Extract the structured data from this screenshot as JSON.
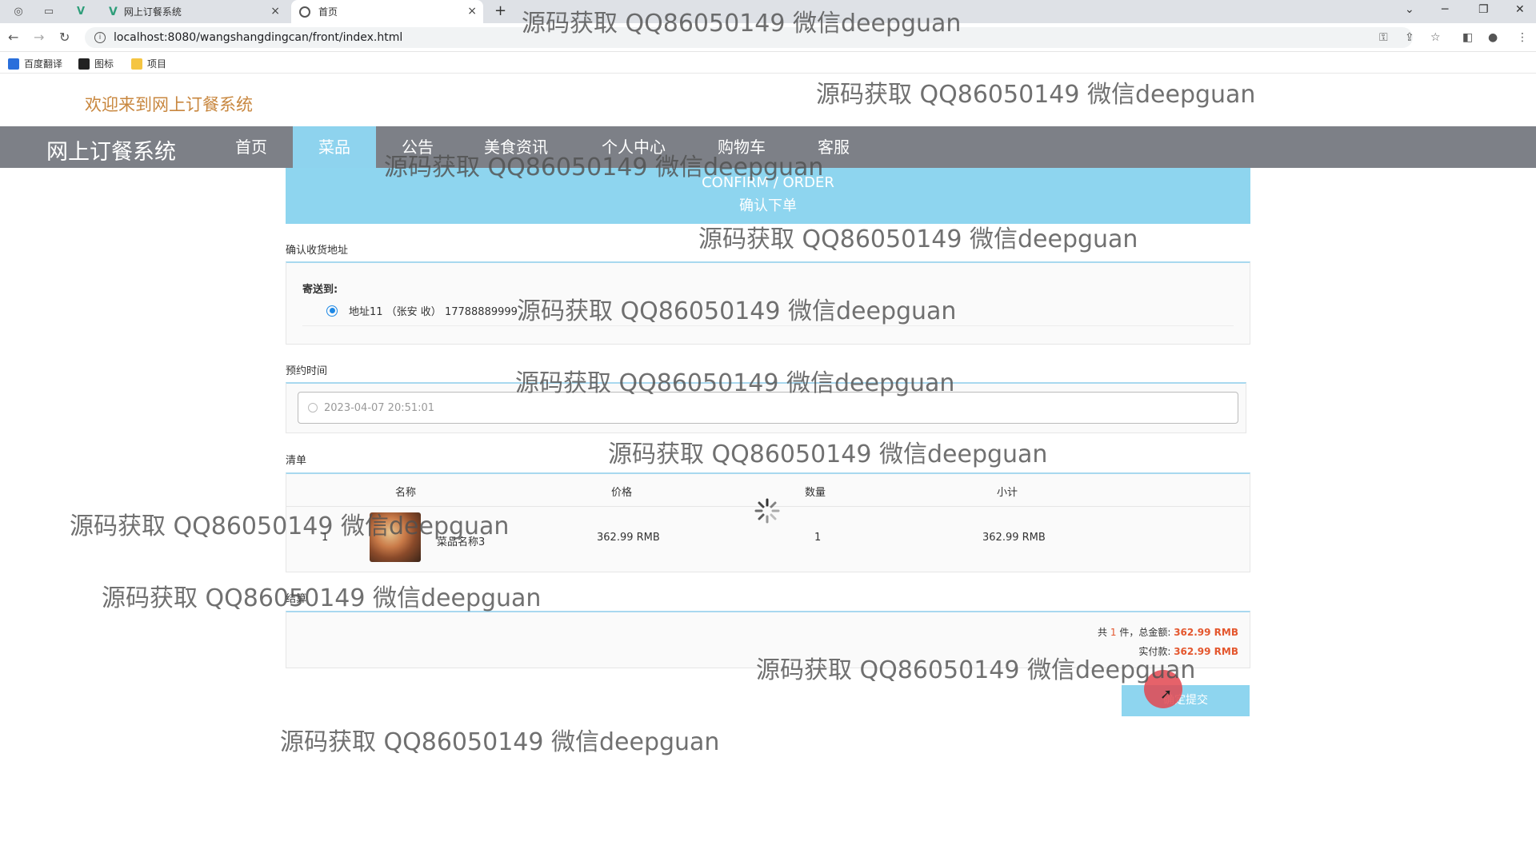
{
  "browser": {
    "tabs": [
      {
        "title": "网上订餐系统",
        "close": "×"
      },
      {
        "title": "首页",
        "close": "×"
      }
    ],
    "new_tab": "+",
    "url": "localhost:8080/wangshangdingcan/front/index.html",
    "bookmarks": [
      "百度翻译",
      "图标",
      "项目"
    ]
  },
  "page": {
    "welcome": "欢迎来到网上订餐系统",
    "brand": "网上订餐系统",
    "nav": [
      "首页",
      "菜品",
      "公告",
      "美食资讯",
      "个人中心",
      "购物车",
      "客服"
    ],
    "active_nav": "菜品",
    "banner_en": "CONFIRM / ORDER",
    "banner_zh": "确认下单",
    "address": {
      "section_title": "确认收货地址",
      "ship_to": "寄送到:",
      "entry": "地址11 （张安 收） 17788889999"
    },
    "appointment": {
      "section_title": "预约时间",
      "value": "2023-04-07 20:51:01"
    },
    "list": {
      "section_title": "清单",
      "headers": [
        "名称",
        "价格",
        "数量",
        "小计"
      ],
      "rows": [
        {
          "index": "1",
          "name": "菜品名称3",
          "price": "362.99 RMB",
          "qty": "1",
          "subtotal": "362.99 RMB"
        }
      ]
    },
    "settle": {
      "section_title": "结算",
      "count_prefix": "共",
      "count": "1",
      "count_suffix": "件，总金额:",
      "total": "362.99 RMB",
      "paid_label": "实付款:",
      "paid": "362.99 RMB"
    },
    "submit": "确定提交"
  },
  "watermark": "源码获取 QQ86050149 微信deepguan",
  "colors": {
    "navbar": "#7d8087",
    "accent": "#8ed5ef",
    "welcome": "#c8873f",
    "price": "#e4572e"
  }
}
